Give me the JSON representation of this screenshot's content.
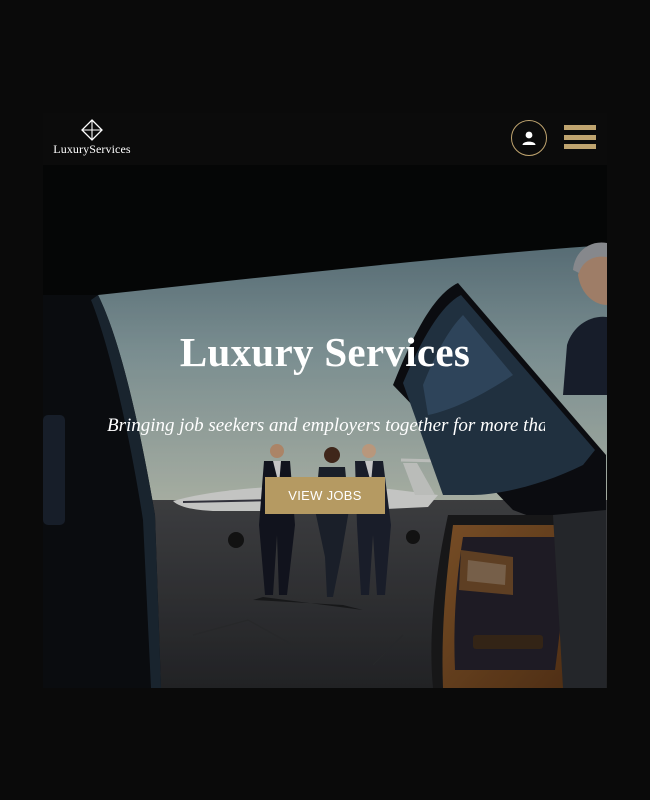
{
  "header": {
    "logo_text": "LuxuryServices",
    "icons": {
      "logo": "diamond-icon",
      "account": "user-icon",
      "menu": "hamburger-menu-icon"
    }
  },
  "hero": {
    "title": "Luxury Services",
    "subtitle": "Bringing job seekers and employers together for more tha",
    "cta_label": "VIEW JOBS"
  },
  "colors": {
    "accent": "#b59a62",
    "background": "#0b0b0b",
    "text": "#ffffff"
  }
}
